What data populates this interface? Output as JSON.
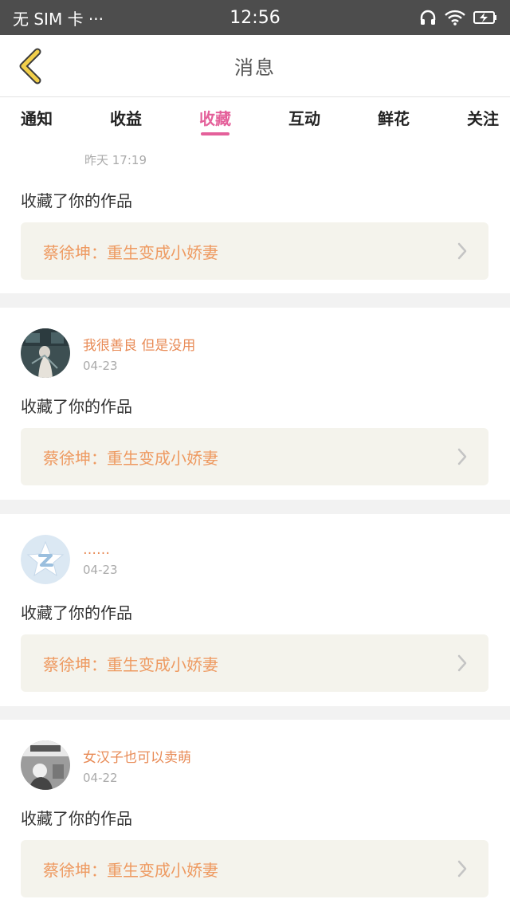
{
  "status_bar": {
    "carrier": "无 SIM 卡 ···",
    "time": "12:56",
    "icons": [
      "headphones-icon",
      "wifi-icon",
      "battery-icon"
    ]
  },
  "header": {
    "title": "消息",
    "back_icon": "chevron-left-icon"
  },
  "tabs": [
    {
      "label": "通知",
      "active": false
    },
    {
      "label": "收益",
      "active": false
    },
    {
      "label": "收藏",
      "active": true
    },
    {
      "label": "互动",
      "active": false
    },
    {
      "label": "鲜花",
      "active": false
    },
    {
      "label": "关注",
      "active": false
    }
  ],
  "colors": {
    "accent": "#e4609a",
    "username": "#e88a55",
    "work_title": "#ee9a61",
    "link_bg": "#f4f3ec",
    "status_bar_bg": "#4d4d4d"
  },
  "cards": [
    {
      "date": "昨天 17:19",
      "action": "收藏了你的作品",
      "work_title": "蔡徐坤：重生变成小娇妻"
    },
    {
      "username": "我很善良 但是没用",
      "date": "04-23",
      "action": "收藏了你的作品",
      "work_title": "蔡徐坤：重生变成小娇妻"
    },
    {
      "username": "……",
      "date": "04-23",
      "action": "收藏了你的作品",
      "work_title": "蔡徐坤：重生变成小娇妻"
    },
    {
      "username": "女汉子也可以卖萌",
      "date": "04-22",
      "action": "收藏了你的作品",
      "work_title": "蔡徐坤：重生变成小娇妻"
    }
  ]
}
